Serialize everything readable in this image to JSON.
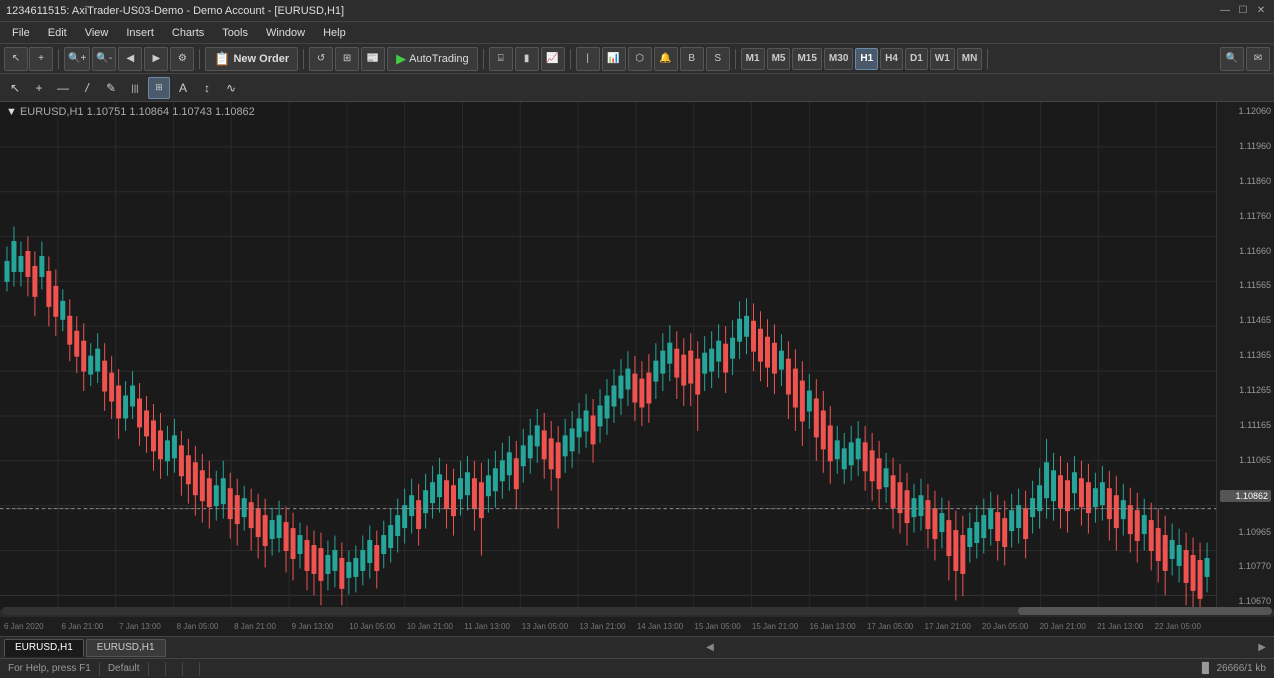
{
  "titlebar": {
    "title": "1234611515: AxiTrader-US03-Demo - Demo Account - [EURUSD,H1]",
    "min_btn": "—",
    "max_btn": "☐",
    "close_btn": "✕"
  },
  "menubar": {
    "items": [
      "File",
      "Edit",
      "View",
      "Insert",
      "Charts",
      "Tools",
      "Window",
      "Help"
    ]
  },
  "toolbar1": {
    "new_order_label": "New Order",
    "autotrading_label": "AutoTrading",
    "timeframes": [
      "M1",
      "M5",
      "M15",
      "M30",
      "H1",
      "H4",
      "D1",
      "W1",
      "MN"
    ],
    "active_timeframe": "H1"
  },
  "chart": {
    "symbol": "EURUSD,H1",
    "ohlc": "1.10751  1.10864  1.10743  1.10862",
    "prices": {
      "high": "1.12060",
      "p1": "1.11960",
      "p2": "1.11860",
      "p3": "1.11760",
      "p4": "1.11660",
      "p5": "1.11565",
      "p6": "1.11465",
      "p7": "1.11365",
      "p8": "1.11265",
      "p9": "1.11165",
      "p10": "1.11065",
      "current": "1.10862",
      "p11": "1.10965",
      "p12": "1.10770",
      "low": "1.10670"
    },
    "dates": [
      "6 Jan 2020",
      "6 Jan 21:00",
      "7 Jan 13:00",
      "8 Jan 05:00",
      "8 Jan 21:00",
      "9 Jan 13:00",
      "10 Jan 05:00",
      "10 Jan 21:00",
      "11 Jan 13:00",
      "13 Jan 05:00",
      "13 Jan 21:00",
      "14 Jan 13:00",
      "15 Jan 05:00",
      "15 Jan 21:00",
      "16 Jan 13:00",
      "17 Jan 05:00",
      "17 Jan 21:00",
      "20 Jan 05:00",
      "20 Jan 21:00",
      "21 Jan 13:00",
      "22 Jan 05:00"
    ]
  },
  "tabs": {
    "items": [
      "EURUSD,H1",
      "EURUSD,H1"
    ]
  },
  "statusbar": {
    "help_text": "For Help, press F1",
    "profile": "Default",
    "memory": "26666/1 kb"
  },
  "drawing_tools": {
    "cursor": "↖",
    "crosshair": "+",
    "line_h": "—",
    "line_diag": "/",
    "pen": "✎",
    "text": "A",
    "arrow": "↕",
    "wave": "~"
  }
}
